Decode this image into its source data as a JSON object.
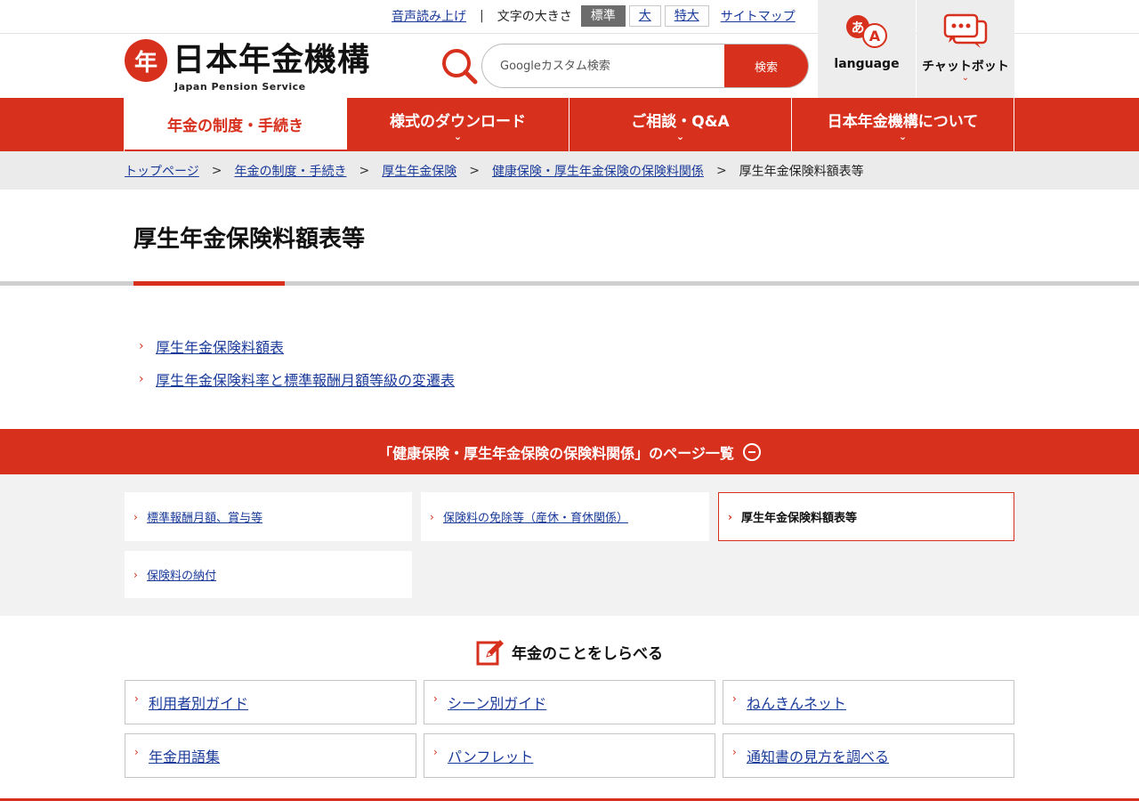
{
  "utility": {
    "read_aloud": "音声読み上げ",
    "separator": "|",
    "font_size_label": "文字の大きさ",
    "font_sizes": [
      "標準",
      "大",
      "特大"
    ],
    "sitemap": "サイトマップ"
  },
  "header": {
    "logo_mark": "年",
    "logo_name": "日本年金機構",
    "logo_en": "Japan Pension Service",
    "search_placeholder": "Googleカスタム検索",
    "search_button": "検索",
    "language_label": "language",
    "chatbot_label": "チャットボット"
  },
  "nav": {
    "items": [
      {
        "label": "年金の制度・手続き"
      },
      {
        "label": "様式のダウンロード"
      },
      {
        "label": "ご相談・Q&A"
      },
      {
        "label": "日本年金機構について"
      }
    ]
  },
  "breadcrumb": {
    "separator": ">",
    "items": [
      "トップページ",
      "年金の制度・手続き",
      "厚生年金保険",
      "健康保険・厚生年金保険の保険料関係"
    ],
    "current": "厚生年金保険料額表等"
  },
  "page": {
    "title": "厚生年金保険料額表等",
    "links": [
      "厚生年金保険料額表",
      "厚生年金保険料率と標準報酬月額等級の変遷表"
    ]
  },
  "related": {
    "heading": "「健康保険・厚生年金保険の保険料関係」のページ一覧",
    "items": [
      "標準報酬月額、賞与等",
      "保険料の免除等（産休・育休関係）",
      "厚生年金保険料額表等",
      "保険料の納付"
    ]
  },
  "research": {
    "title": "年金のことをしらべる",
    "items": [
      "利用者別ガイド",
      "シーン別ガイド",
      "ねんきんネット",
      "年金用語集",
      "パンフレット",
      "通知書の見方を調べる"
    ]
  },
  "colors": {
    "brand_red": "#d7301d",
    "link_blue": "#1a3a9a",
    "header_button_bg": "#ededed",
    "breadcrumb_bg": "#ebebeb"
  },
  "icons": {
    "search": "search-icon",
    "language": "language-icon",
    "chatbot": "chat-bubble-icon",
    "arrow": "chevron-right-icon",
    "section": "pencil-note-icon",
    "collapse": "minus-circle-icon"
  }
}
